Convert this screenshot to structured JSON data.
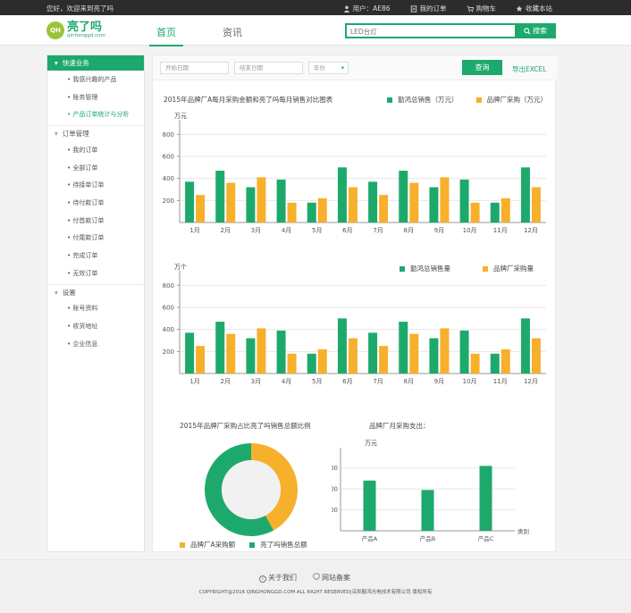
{
  "topbar": {
    "greeting": "您好，欢迎来到亮了吗",
    "user": "用户：AE86",
    "orders": "我的订单",
    "cart": "购物车",
    "favorite": "收藏本站"
  },
  "header": {
    "logo_badge": "QH",
    "logo_text": "亮了吗",
    "logo_sub": "qinhonggd.com",
    "nav": [
      "首页",
      "资讯"
    ],
    "search_placeholder": "LED台灯",
    "search_button": "搜索"
  },
  "sidebar": {
    "sections": [
      {
        "title": "快速业务",
        "items": [
          "我感兴趣的产品",
          "账务管理",
          "产品订单统计与分析"
        ]
      },
      {
        "title": "订单管理",
        "items": [
          "我的订单",
          "全部订单",
          "待接单订单",
          "待付款订单",
          "付首款订单",
          "付尾款订单",
          "完成订单",
          "无效订单"
        ]
      },
      {
        "title": "设置",
        "items": [
          "账号资料",
          "收货地址",
          "企业信息"
        ]
      }
    ]
  },
  "filter": {
    "start_date": "开始日期",
    "end_date": "结束日期",
    "year": "年份",
    "query": "查询",
    "export": "导出EXCEL"
  },
  "chart1_title": "2015年品牌厂A每月采购金额和亮了吗每月销售对比图表",
  "chart3_title": "2015年品牌厂采购占比亮了吗销售总额比例",
  "chart4_title": "品牌厂月采购支出：",
  "chart_data": [
    {
      "type": "bar",
      "title": "2015年品牌厂A每月采购金额和亮了吗每月销售对比图表",
      "ylabel": "万元",
      "ylim": [
        0,
        900
      ],
      "yticks": [
        200,
        400,
        600,
        800
      ],
      "categories": [
        "1月",
        "2月",
        "3月",
        "4月",
        "5月",
        "6月",
        "7月",
        "8月",
        "9月",
        "10月",
        "11月",
        "12月"
      ],
      "series": [
        {
          "name": "勤鸿总销售（万元）",
          "color": "#1ea96c",
          "values": [
            370,
            470,
            320,
            390,
            180,
            500,
            370,
            470,
            320,
            390,
            180,
            500
          ]
        },
        {
          "name": "品牌厂采购（万元）",
          "color": "#f6b02c",
          "values": [
            250,
            360,
            410,
            180,
            220,
            320,
            250,
            360,
            410,
            180,
            220,
            320
          ]
        }
      ],
      "legend": "top-right",
      "grid": true
    },
    {
      "type": "bar",
      "ylabel": "万个",
      "ylim": [
        0,
        900
      ],
      "yticks": [
        200,
        400,
        600,
        800
      ],
      "categories": [
        "1月",
        "2月",
        "3月",
        "4月",
        "5月",
        "6月",
        "7月",
        "8月",
        "9月",
        "10月",
        "11月",
        "12月"
      ],
      "series": [
        {
          "name": "勤鸿总销售量",
          "color": "#1ea96c",
          "values": [
            370,
            470,
            320,
            390,
            180,
            500,
            370,
            470,
            320,
            390,
            180,
            500
          ]
        },
        {
          "name": "品牌厂采购量",
          "color": "#f6b02c",
          "values": [
            250,
            360,
            410,
            180,
            220,
            320,
            250,
            360,
            410,
            180,
            220,
            320
          ]
        }
      ],
      "legend": "top-right",
      "grid": true
    },
    {
      "type": "pie",
      "title": "2015年品牌厂采购占比亮了吗销售总额比例",
      "slices": [
        {
          "name": "品牌厂A采购额",
          "color": "#f6b02c",
          "value": 42
        },
        {
          "name": "亮了吗销售总额",
          "color": "#1ea96c",
          "value": 58
        }
      ],
      "legend": "bottom"
    },
    {
      "type": "bar",
      "title": "品牌厂月采购支出：",
      "ylabel": "万元",
      "xlabel": "类别",
      "ylim": [
        0,
        380
      ],
      "yticks": [
        100,
        200,
        300
      ],
      "categories": [
        "产品A",
        "产品B",
        "产品C"
      ],
      "values": [
        240,
        195,
        310
      ],
      "color": "#1ea96c",
      "grid": true
    }
  ],
  "footer": {
    "about": "关于我们",
    "record": "网站备案",
    "copyright": "COPYRIGHT@2016 QINGHONGGD.COM ALL RIGHT RESERVED|深圳勤鸿光电技术有限公司 版权所有"
  }
}
